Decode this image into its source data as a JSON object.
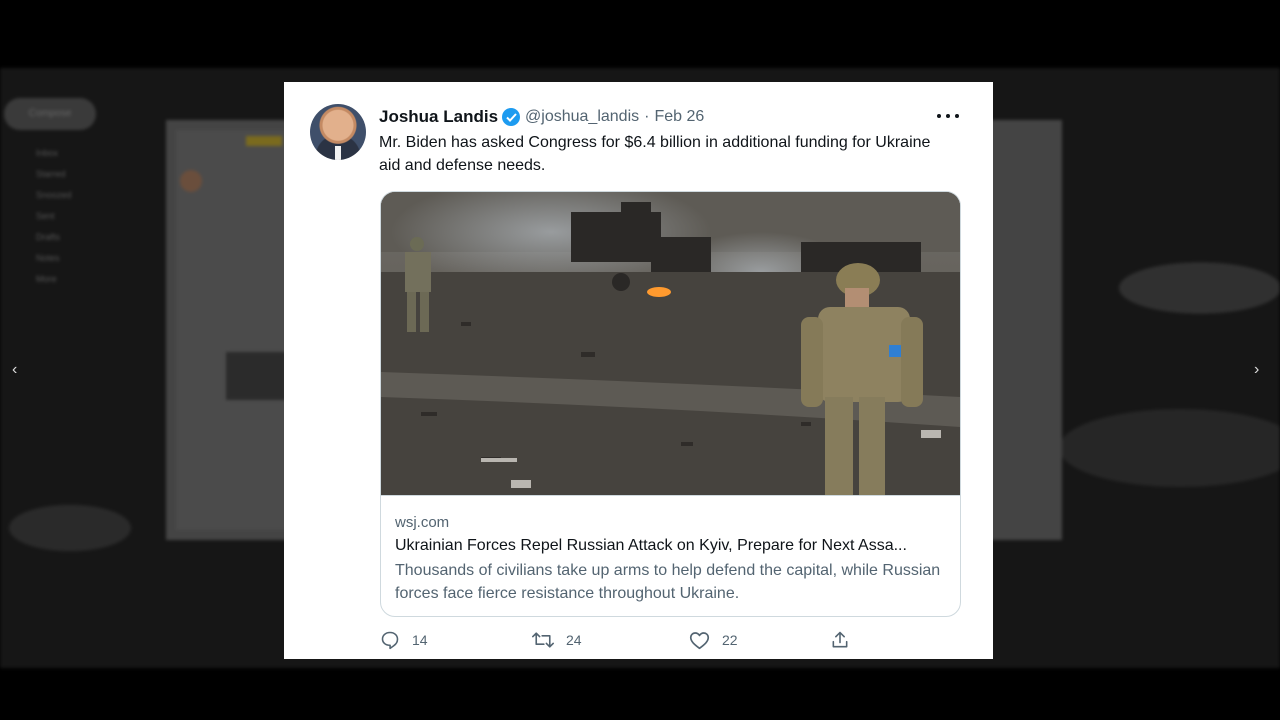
{
  "background": {
    "compose_label": "Compose",
    "sidebar_items": [
      "Inbox",
      "Starred",
      "Snoozed",
      "Sent",
      "Drafts",
      "Notes",
      "More"
    ],
    "nav_prev": "‹",
    "nav_next": "›"
  },
  "tweet": {
    "author_name": "Joshua Landis",
    "handle": "@joshua_landis",
    "separator": "·",
    "date": "Feb 26",
    "verified_icon": "verified-badge-icon",
    "body": "Mr. Biden has asked Congress for $6.4 billion in additional funding for Ukraine aid and defense needs.",
    "link_card": {
      "domain": "wsj.com",
      "title": "Ukrainian Forces Repel Russian Attack on Kyiv, Prepare for Next Assa...",
      "description": "Thousands of civilians take up arms to help defend the capital, while Russian forces face fierce resistance throughout Ukraine."
    },
    "actions": {
      "replies": "14",
      "retweets": "24",
      "likes": "22"
    }
  },
  "colors": {
    "accent": "#1d9bf0",
    "text_primary": "#0f1419",
    "text_secondary": "#536471"
  }
}
